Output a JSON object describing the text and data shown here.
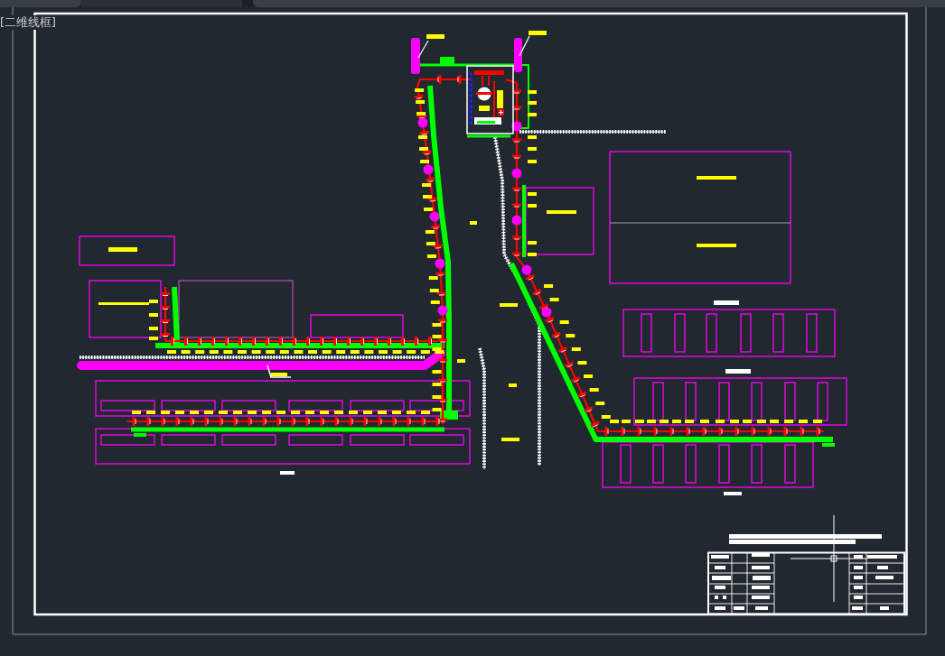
{
  "viewport": {
    "label": "[二维线框]"
  }
}
